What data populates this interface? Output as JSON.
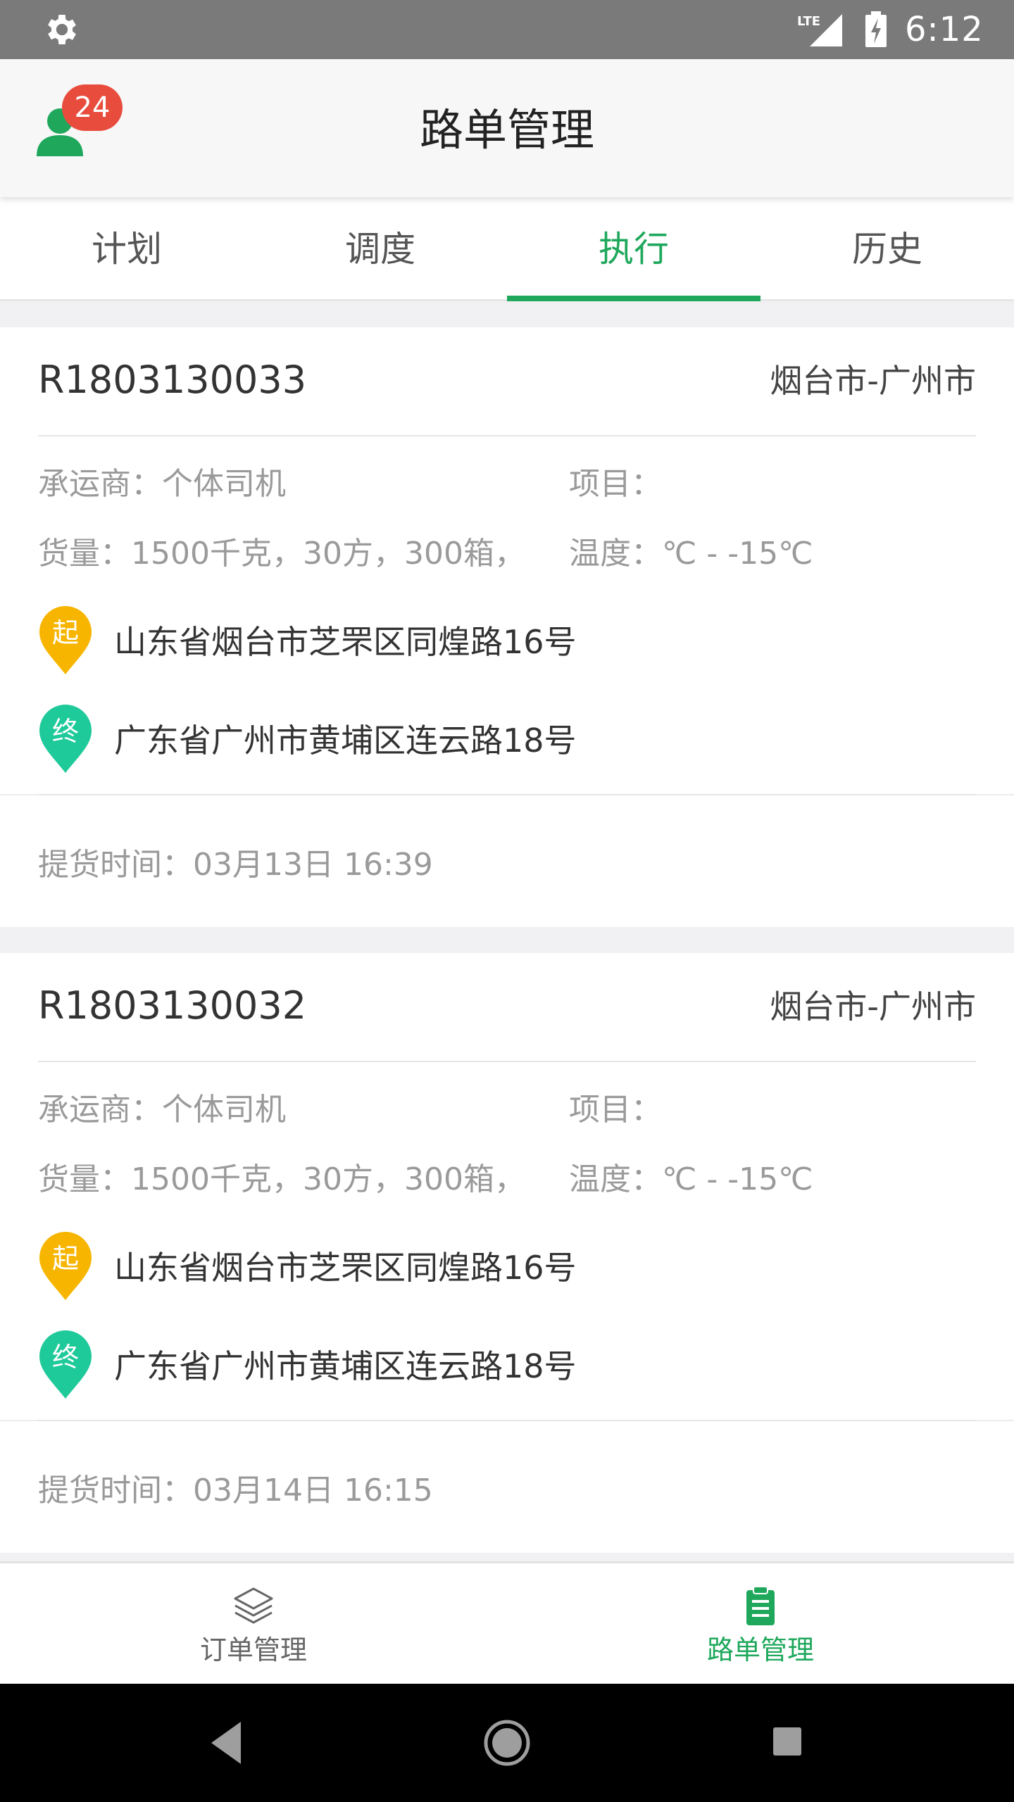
{
  "status_bar": {
    "time": "6:12",
    "network": "LTE"
  },
  "header": {
    "title": "路单管理",
    "badge_count": "24"
  },
  "tabs": [
    {
      "label": "计划",
      "active": false
    },
    {
      "label": "调度",
      "active": false
    },
    {
      "label": "执行",
      "active": true
    },
    {
      "label": "历史",
      "active": false
    }
  ],
  "routes": [
    {
      "id": "R1803130033",
      "cities": "烟台市-广州市",
      "carrier": "承运商：个体司机",
      "project": "项目：",
      "cargo": "货量：1500千克，30方，300箱，",
      "temperature": "温度：℃ - -15℃",
      "start_marker": "起",
      "start_address": "山东省烟台市芝罘区同煌路16号",
      "end_marker": "终",
      "end_address": "广东省广州市黄埔区连云路18号",
      "pickup_time": "提货时间：03月13日 16:39"
    },
    {
      "id": "R1803130032",
      "cities": "烟台市-广州市",
      "carrier": "承运商：个体司机",
      "project": "项目：",
      "cargo": "货量：1500千克，30方，300箱，",
      "temperature": "温度：℃ - -15℃",
      "start_marker": "起",
      "start_address": "山东省烟台市芝罘区同煌路16号",
      "end_marker": "终",
      "end_address": "广东省广州市黄埔区连云路18号",
      "pickup_time": "提货时间：03月14日 16:15"
    }
  ],
  "bottom_nav": [
    {
      "label": "订单管理",
      "icon": "layers-icon",
      "active": false
    },
    {
      "label": "路单管理",
      "icon": "clipboard-icon",
      "active": true
    }
  ],
  "colors": {
    "accent": "#1fa85c",
    "badge": "#e84c3d",
    "start_pin": "#f7b500",
    "end_pin": "#1ec99a"
  }
}
